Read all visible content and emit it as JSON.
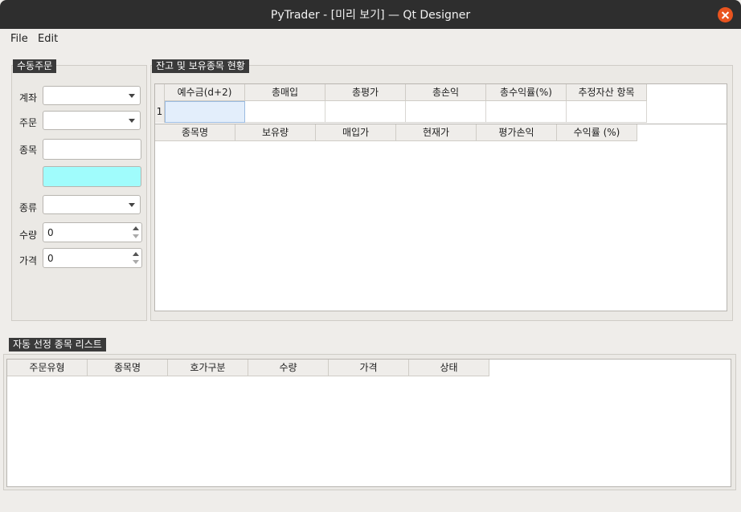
{
  "window": {
    "title": "PyTrader - [미리 보기] — Qt Designer"
  },
  "menubar": {
    "items": [
      "File",
      "Edit"
    ]
  },
  "manual_order": {
    "title": "수동주문",
    "labels": {
      "account": "계좌",
      "order": "주문",
      "stock": "종목",
      "type": "종류",
      "quantity": "수량",
      "price": "가격"
    },
    "quantity_value": "0",
    "price_value": "0"
  },
  "balance": {
    "title": "잔고 및 보유종목 현황",
    "summary_headers": [
      "예수금(d+2)",
      "총매입",
      "총평가",
      "총손익",
      "총수익률(%)",
      "추정자산 항목"
    ],
    "summary_row_label": "1",
    "holdings_headers": [
      "종목명",
      "보유량",
      "매입가",
      "현재가",
      "평가손익",
      "수익률 (%)"
    ]
  },
  "auto_list": {
    "title": "자동 선정 종목 리스트",
    "headers": [
      "주문유형",
      "종목명",
      "호가구분",
      "수량",
      "가격",
      "상태"
    ]
  },
  "colors": {
    "titlebar": "#2e2e2e",
    "close": "#e9541f",
    "cyan_field": "#a0fcfc",
    "selected_cell": "#e3eefb"
  }
}
